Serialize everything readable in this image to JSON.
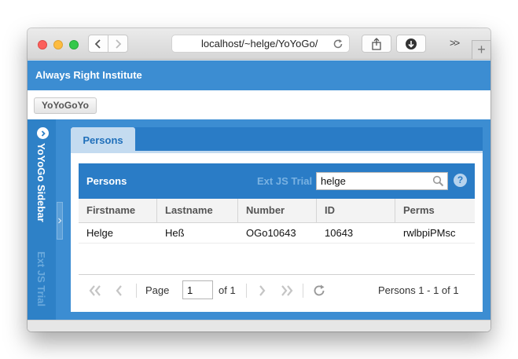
{
  "browser": {
    "url": "localhost/~helge/YoYoGo/",
    "more_label": ">>",
    "newtab_label": "+"
  },
  "app": {
    "header_title": "Always Right Institute",
    "button_label": "YoYoGoYo"
  },
  "sidebar": {
    "title": "YoYoGo Sidebar",
    "trial_label": "Ext JS Trial"
  },
  "tabs": [
    {
      "label": "Persons",
      "active": true
    }
  ],
  "grid": {
    "title": "Persons",
    "trial_label": "Ext JS Trial",
    "search_value": "helge",
    "help_label": "?",
    "columns": [
      "Firstname",
      "Lastname",
      "Number",
      "ID",
      "Perms"
    ],
    "rows": [
      [
        "Helge",
        "Heß",
        "OGo10643",
        "10643",
        "rwlbpiPMsc"
      ]
    ]
  },
  "pager": {
    "page_label": "Page",
    "current_page": "1",
    "of_label": "of 1",
    "summary": "Persons 1 - 1 of 1"
  },
  "colors": {
    "header_blue": "#3c8dd2",
    "panel_blue": "#2a7cc6",
    "tab_active_bg": "#c4dbf0",
    "tab_active_text": "#1f6fba"
  },
  "icons": {
    "back": "chevron-left-icon",
    "forward": "chevron-right-icon",
    "reload": "reload-icon",
    "share": "share-icon",
    "download": "download-icon",
    "search": "search-icon",
    "first": "double-chevron-left-icon",
    "prev": "chevron-left-icon",
    "next": "chevron-right-icon",
    "last": "double-chevron-right-icon",
    "refresh": "refresh-icon"
  }
}
